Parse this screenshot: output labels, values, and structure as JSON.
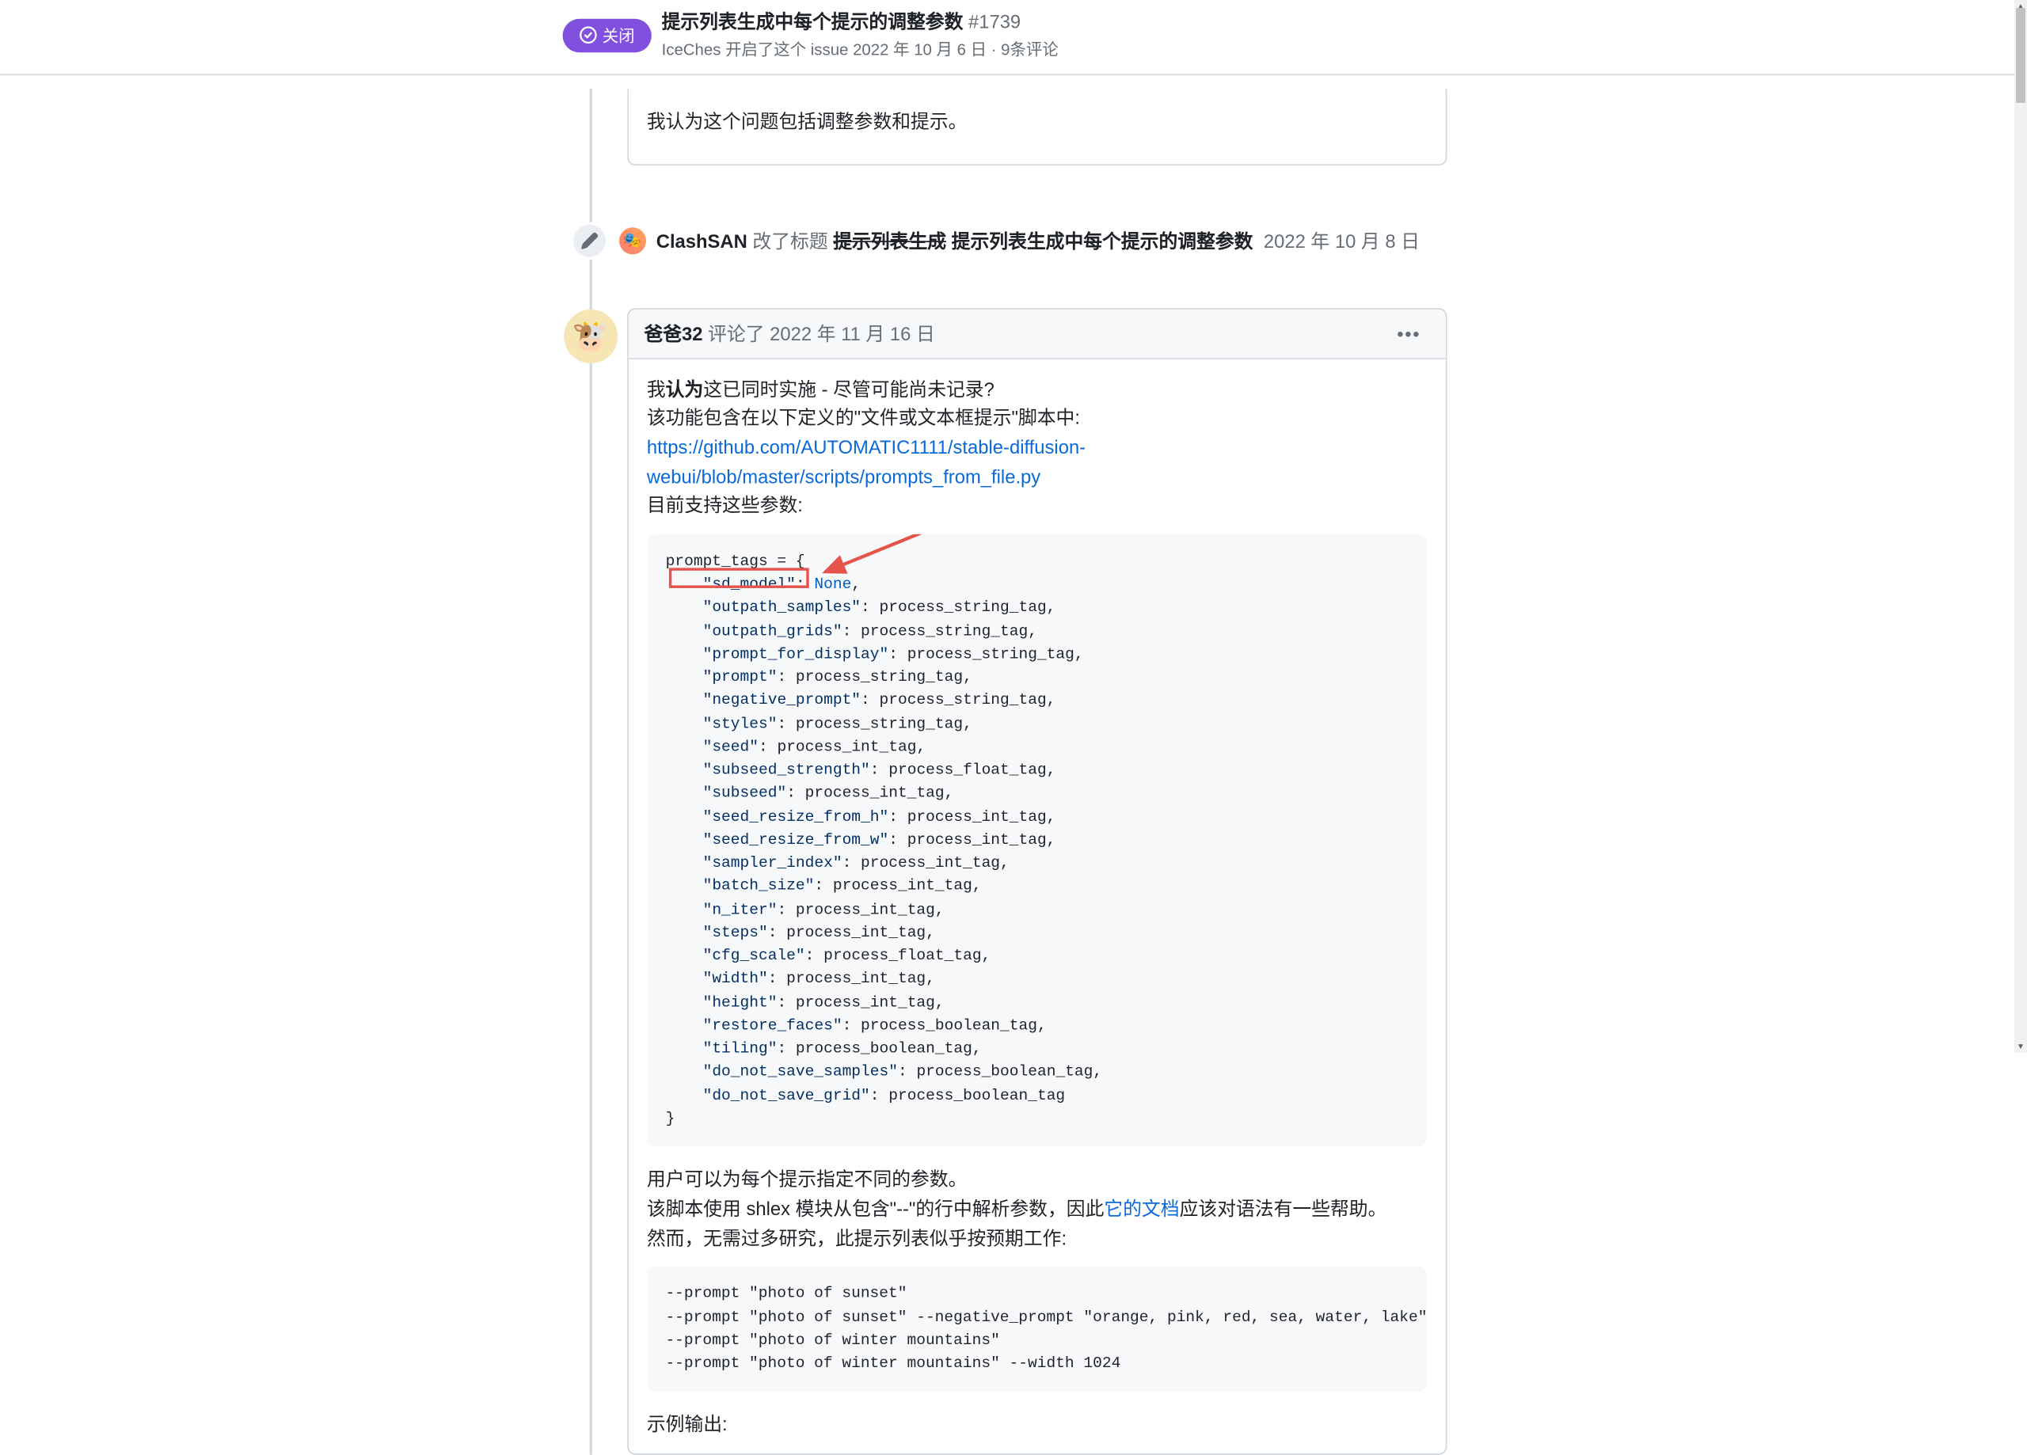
{
  "header": {
    "state_label": "关闭",
    "title": "提示列表生成中每个提示的调整参数",
    "issue_number": "#1739",
    "sub_author": "IceChes",
    "sub_text_before": " 开启了这个 issue ",
    "sub_date": "2022 年 10 月 6 日",
    "sub_text_after": " · 9条评论"
  },
  "prev_comment_text": "我认为这个问题包括调整参数和提示。",
  "title_event": {
    "avatar_emoji": "🎭",
    "user": "ClashSAN",
    "action": " 改了标题 ",
    "old_title": "提示列表生成",
    "new_title": " 提示列表生成中每个提示的调整参数",
    "date": "2022 年 10 月 8 日"
  },
  "comment": {
    "avatar_emoji": "🐮",
    "author": "爸爸32",
    "action": " 评论了 ",
    "date": "2022 年 11 月 16 日",
    "p1_prefix": "我",
    "p1_bold": "认为",
    "p1_suffix": "这已同时实施 - 尽管可能尚未记录?",
    "p2": "该功能包含在以下定义的\"文件或文本框提示\"脚本中:",
    "link": "https://github.com/AUTOMATIC1111/stable-diffusion-webui/blob/master/scripts/prompts_from_file.py",
    "p3": "目前支持这些参数:",
    "code1_lines": [
      {
        "plain_pre": "prompt_tags = {"
      },
      {
        "key": "\"sd_model\"",
        "val_kw": "None",
        "comma": ","
      },
      {
        "key": "\"outpath_samples\"",
        "val": "process_string_tag,"
      },
      {
        "key": "\"outpath_grids\"",
        "val": "process_string_tag,"
      },
      {
        "key": "\"prompt_for_display\"",
        "val": "process_string_tag,"
      },
      {
        "key": "\"prompt\"",
        "val": "process_string_tag,"
      },
      {
        "key": "\"negative_prompt\"",
        "val": "process_string_tag,"
      },
      {
        "key": "\"styles\"",
        "val": "process_string_tag,"
      },
      {
        "key": "\"seed\"",
        "val": "process_int_tag,"
      },
      {
        "key": "\"subseed_strength\"",
        "val": "process_float_tag,"
      },
      {
        "key": "\"subseed\"",
        "val": "process_int_tag,"
      },
      {
        "key": "\"seed_resize_from_h\"",
        "val": "process_int_tag,"
      },
      {
        "key": "\"seed_resize_from_w\"",
        "val": "process_int_tag,"
      },
      {
        "key": "\"sampler_index\"",
        "val": "process_int_tag,"
      },
      {
        "key": "\"batch_size\"",
        "val": "process_int_tag,"
      },
      {
        "key": "\"n_iter\"",
        "val": "process_int_tag,"
      },
      {
        "key": "\"steps\"",
        "val": "process_int_tag,"
      },
      {
        "key": "\"cfg_scale\"",
        "val": "process_float_tag,"
      },
      {
        "key": "\"width\"",
        "val": "process_int_tag,"
      },
      {
        "key": "\"height\"",
        "val": "process_int_tag,"
      },
      {
        "key": "\"restore_faces\"",
        "val": "process_boolean_tag,"
      },
      {
        "key": "\"tiling\"",
        "val": "process_boolean_tag,"
      },
      {
        "key": "\"do_not_save_samples\"",
        "val": "process_boolean_tag,"
      },
      {
        "key": "\"do_not_save_grid\"",
        "val": "process_boolean_tag"
      },
      {
        "plain_pre": "}"
      }
    ],
    "p4": "用户可以为每个提示指定不同的参数。",
    "p5_before": "该脚本使用 shlex 模块从包含\"--\"的行中解析参数，因此",
    "p5_link": "它的文档",
    "p5_after": "应该对语法有一些帮助。",
    "p6": "然而，无需过多研究，此提示列表似乎按预期工作:",
    "code2": "--prompt \"photo of sunset\"\n--prompt \"photo of sunset\" --negative_prompt \"orange, pink, red, sea, water, lake\" --width 1024\n--prompt \"photo of winter mountains\"\n--prompt \"photo of winter mountains\" --width 1024",
    "p7": "示例输出:"
  }
}
